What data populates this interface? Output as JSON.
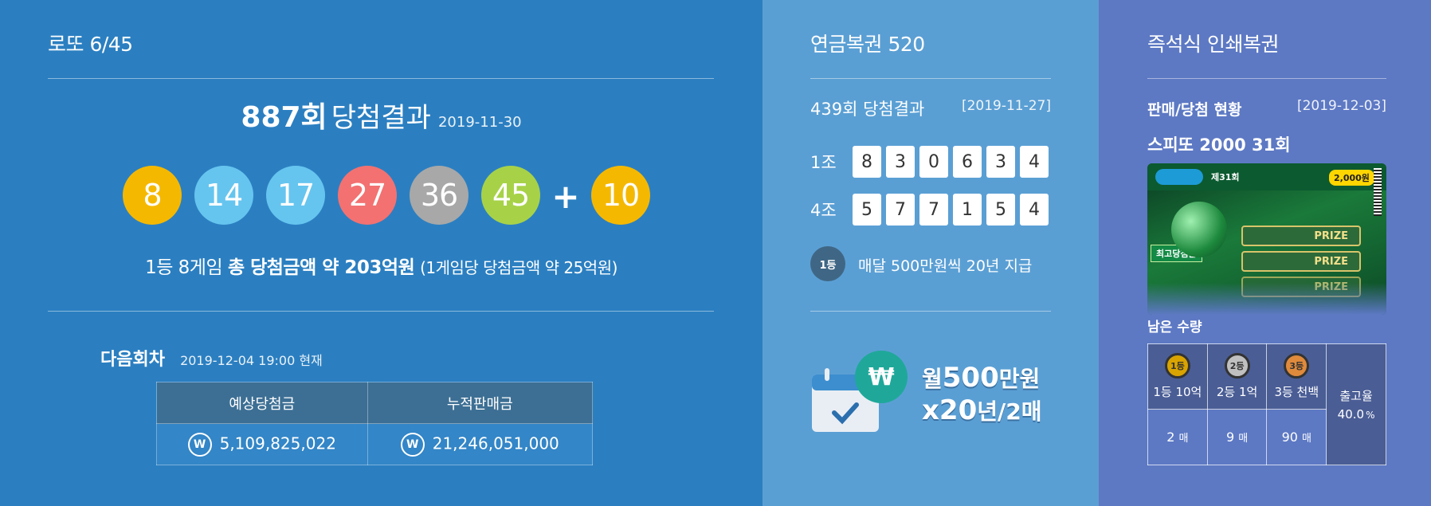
{
  "lotto": {
    "title": "로또 6/45",
    "round_number": "887회",
    "round_suffix": "당첨결과",
    "draw_date": "2019-11-30",
    "balls": [
      {
        "number": "8",
        "color": "#f5b800"
      },
      {
        "number": "14",
        "color": "#66c5ef"
      },
      {
        "number": "17",
        "color": "#66c5ef"
      },
      {
        "number": "27",
        "color": "#f37171"
      },
      {
        "number": "36",
        "color": "#a8a8a8"
      },
      {
        "number": "45",
        "color": "#a7d248"
      }
    ],
    "plus": "+",
    "bonus": {
      "number": "10",
      "color": "#f5b800"
    },
    "prize_prefix": "1등 8게임 ",
    "prize_total_label": "총 당첨금액 약 203억원",
    "prize_per_game": "(1게임당 당첨금액 약 25억원)",
    "next_round_label": "다음회차",
    "next_round_time": "2019-12-04 19:00 현재",
    "table": {
      "headers": [
        "예상당첨금",
        "누적판매금"
      ],
      "won_icon": "W",
      "values": [
        "5,109,825,022",
        "21,246,051,000"
      ]
    }
  },
  "pension": {
    "title": "연금복권 520",
    "result_label": "439회 당첨결과",
    "result_date": "[2019-11-27]",
    "rows": [
      {
        "group": "1조",
        "digits": [
          "8",
          "3",
          "0",
          "6",
          "3",
          "4"
        ]
      },
      {
        "group": "4조",
        "digits": [
          "5",
          "7",
          "7",
          "1",
          "5",
          "4"
        ]
      }
    ],
    "first_badge": "1등",
    "first_desc": "매달 500만원씩 20년 지급",
    "promo_line1_prefix": "월",
    "promo_line1_big": "500",
    "promo_line1_suffix": "만원",
    "promo_line2_big": "x20",
    "promo_line2_suffix": "년/2매",
    "promo_won": "₩"
  },
  "instant": {
    "title": "즉석식 인쇄복권",
    "status_label": "판매/당첨 현황",
    "status_date": "[2019-12-03]",
    "game_name": "스피또 2000 31회",
    "ticket": {
      "round": "제31회",
      "price": "2,000원",
      "prize_word": "PRIZE",
      "top_prize": "최고당첨금"
    },
    "remaining_label": "남은 수량",
    "prizes": [
      {
        "badge": "1등",
        "label": "1등 10억",
        "qty": "2",
        "unit": "매",
        "medal": "#d9a400"
      },
      {
        "badge": "2등",
        "label": "2등 1억",
        "qty": "9",
        "unit": "매",
        "medal": "#c0c0c0"
      },
      {
        "badge": "3등",
        "label": "3등 천백",
        "qty": "90",
        "unit": "매",
        "medal": "#e08a3c"
      }
    ],
    "release_label": "출고율",
    "release_value": "40.0",
    "release_unit": "%"
  }
}
